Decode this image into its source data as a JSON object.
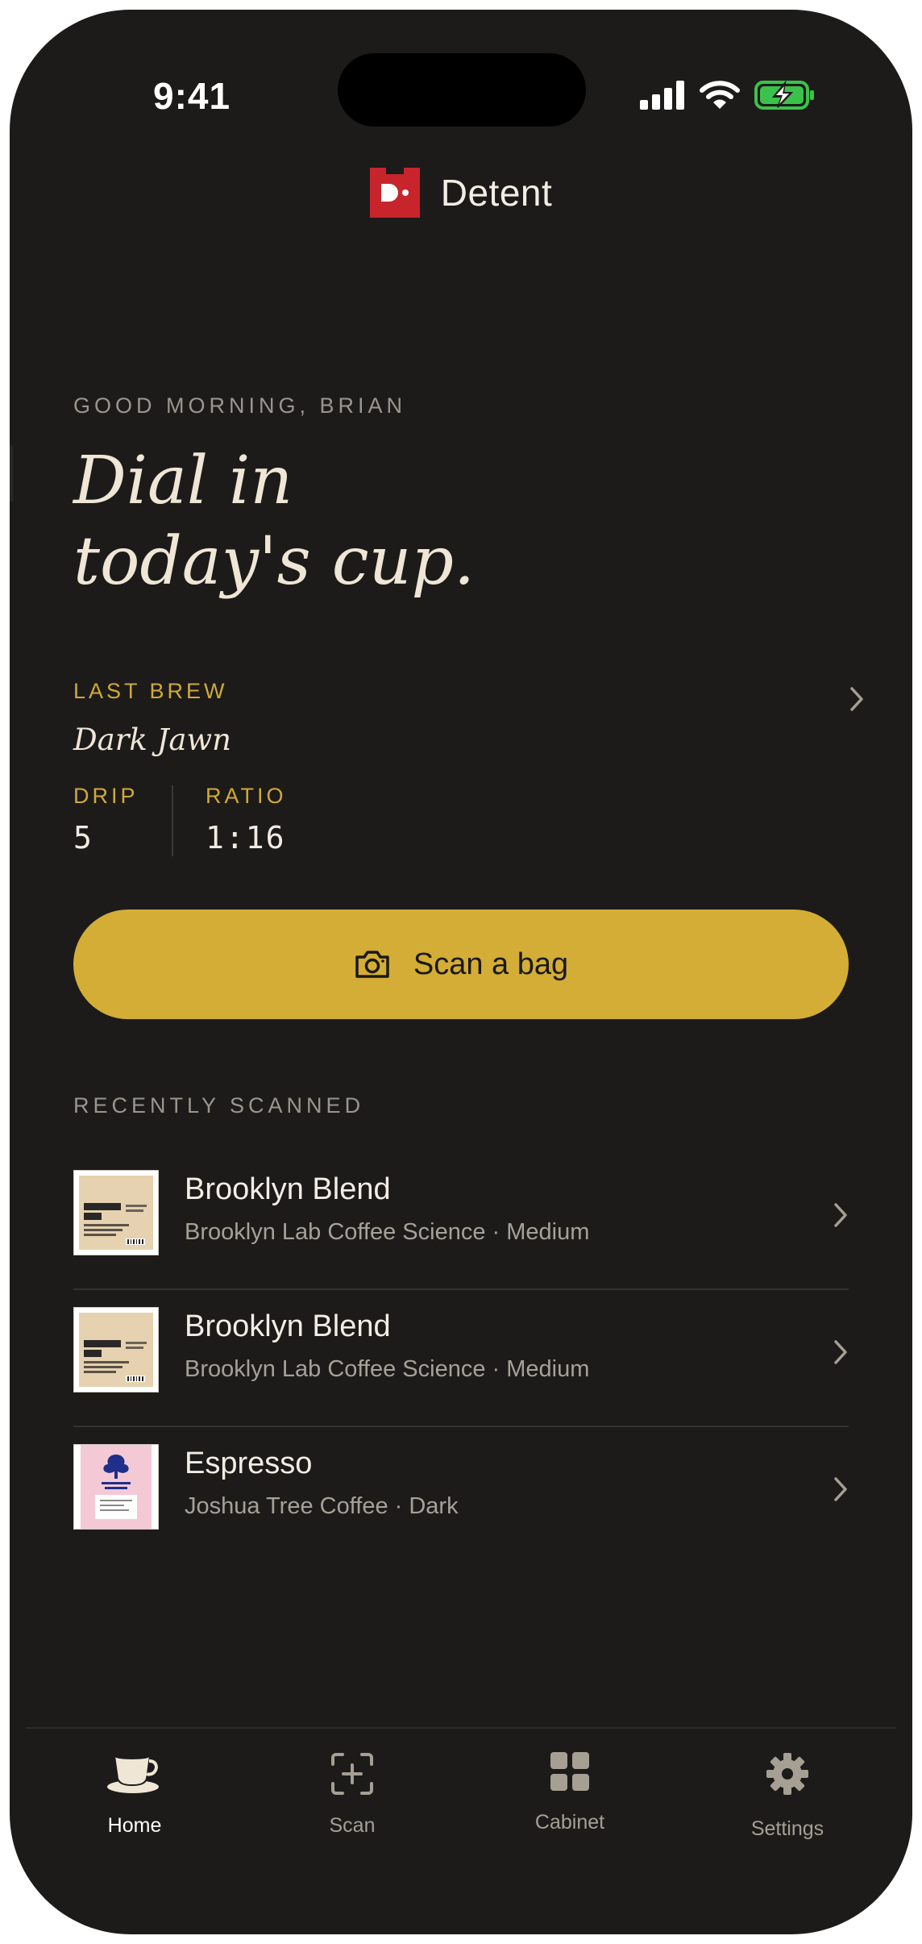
{
  "status_bar": {
    "time": "9:41"
  },
  "header": {
    "app_name": "Detent"
  },
  "greeting": "GOOD MORNING, BRIAN",
  "headline": {
    "line1": "Dial in",
    "line2": "today's cup."
  },
  "last_brew": {
    "label": "LAST BREW",
    "name": "Dark Jawn",
    "stats": [
      {
        "label": "DRIP",
        "value": "5"
      },
      {
        "label": "RATIO",
        "value": "1:16"
      }
    ]
  },
  "scan_button": {
    "label": "Scan a bag"
  },
  "recently_scanned": {
    "label": "RECENTLY SCANNED",
    "items": [
      {
        "title": "Brooklyn Blend",
        "subtitle": "Brooklyn Lab Coffee Science · Medium",
        "thumb": "brooklyn-lab-bag"
      },
      {
        "title": "Brooklyn Blend",
        "subtitle": "Brooklyn Lab Coffee Science · Medium",
        "thumb": "brooklyn-lab-bag"
      },
      {
        "title": "Espresso",
        "subtitle": "Joshua Tree Coffee · Dark",
        "thumb": "joshua-tree-bag"
      }
    ]
  },
  "tabs": [
    {
      "label": "Home",
      "icon": "coffee-cup-icon",
      "active": true
    },
    {
      "label": "Scan",
      "icon": "scan-plus-icon",
      "active": false
    },
    {
      "label": "Cabinet",
      "icon": "grid-icon",
      "active": false
    },
    {
      "label": "Settings",
      "icon": "gear-icon",
      "active": false
    }
  ],
  "colors": {
    "background": "#1c1b1a",
    "accent_gold": "#d4ad36",
    "label_gold": "#d2a938",
    "brand_red": "#c8242b",
    "text_primary": "#efe6d6",
    "text_muted": "#9b968d",
    "battery_green": "#3bc24a"
  }
}
